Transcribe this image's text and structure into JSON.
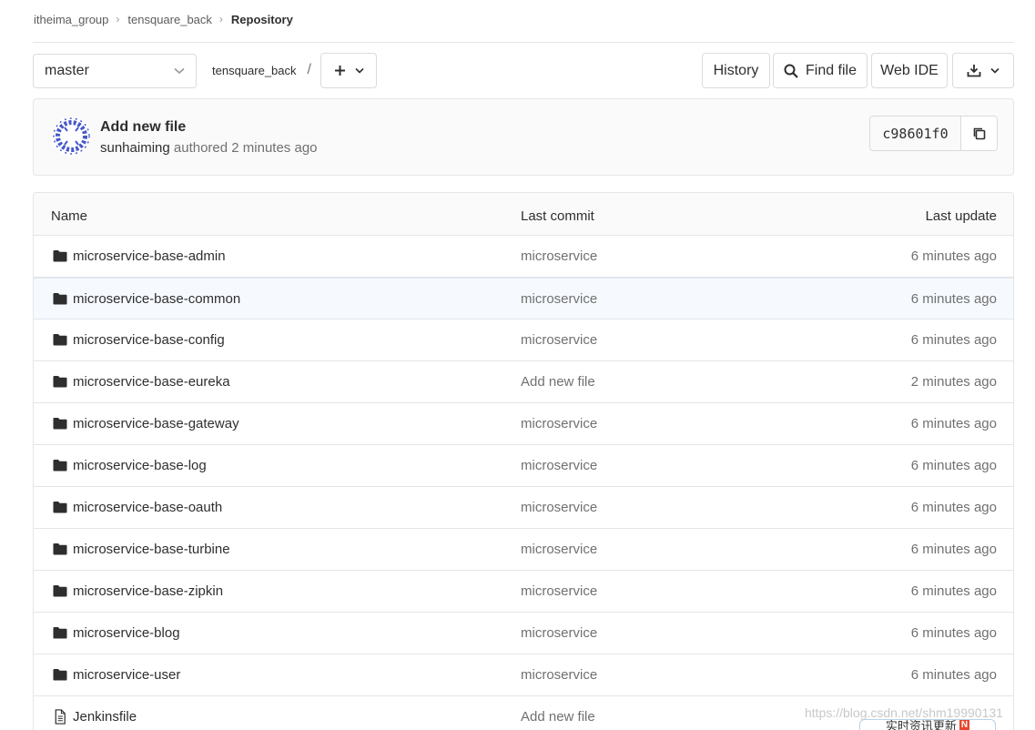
{
  "breadcrumb": {
    "group": "itheima_group",
    "project": "tensquare_back",
    "current": "Repository"
  },
  "toolbar": {
    "branch": "master",
    "path_root": "tensquare_back",
    "path_sep": "/",
    "history": "History",
    "find_file": "Find file",
    "web_ide": "Web IDE"
  },
  "last_commit": {
    "title": "Add new file",
    "author": "sunhaiming",
    "meta": "authored 2 minutes ago",
    "sha": "c98601f0"
  },
  "table": {
    "headers": {
      "name": "Name",
      "last_commit": "Last commit",
      "last_update": "Last update"
    },
    "rows": [
      {
        "type": "folder",
        "name": "microservice-base-admin",
        "commit": "microservice",
        "updated": "6 minutes ago"
      },
      {
        "type": "folder",
        "name": "microservice-base-common",
        "commit": "microservice",
        "updated": "6 minutes ago"
      },
      {
        "type": "folder",
        "name": "microservice-base-config",
        "commit": "microservice",
        "updated": "6 minutes ago"
      },
      {
        "type": "folder",
        "name": "microservice-base-eureka",
        "commit": "Add new file",
        "updated": "2 minutes ago"
      },
      {
        "type": "folder",
        "name": "microservice-base-gateway",
        "commit": "microservice",
        "updated": "6 minutes ago"
      },
      {
        "type": "folder",
        "name": "microservice-base-log",
        "commit": "microservice",
        "updated": "6 minutes ago"
      },
      {
        "type": "folder",
        "name": "microservice-base-oauth",
        "commit": "microservice",
        "updated": "6 minutes ago"
      },
      {
        "type": "folder",
        "name": "microservice-base-turbine",
        "commit": "microservice",
        "updated": "6 minutes ago"
      },
      {
        "type": "folder",
        "name": "microservice-base-zipkin",
        "commit": "microservice",
        "updated": "6 minutes ago"
      },
      {
        "type": "folder",
        "name": "microservice-blog",
        "commit": "microservice",
        "updated": "6 minutes ago"
      },
      {
        "type": "folder",
        "name": "microservice-user",
        "commit": "microservice",
        "updated": "6 minutes ago"
      },
      {
        "type": "file",
        "name": "Jenkinsfile",
        "commit": "Add new file",
        "updated": ""
      }
    ]
  },
  "overlay": {
    "watermark": "https://blog.csdn.net/shm19990131",
    "badge_text": "实时资讯更新",
    "badge_letter": "N"
  },
  "icons": {
    "folder": "folder-icon",
    "file": "file-icon",
    "search": "search-icon",
    "download": "download-icon",
    "copy": "copy-icon",
    "chevron": "chevron-down-icon",
    "plus": "plus-icon"
  }
}
